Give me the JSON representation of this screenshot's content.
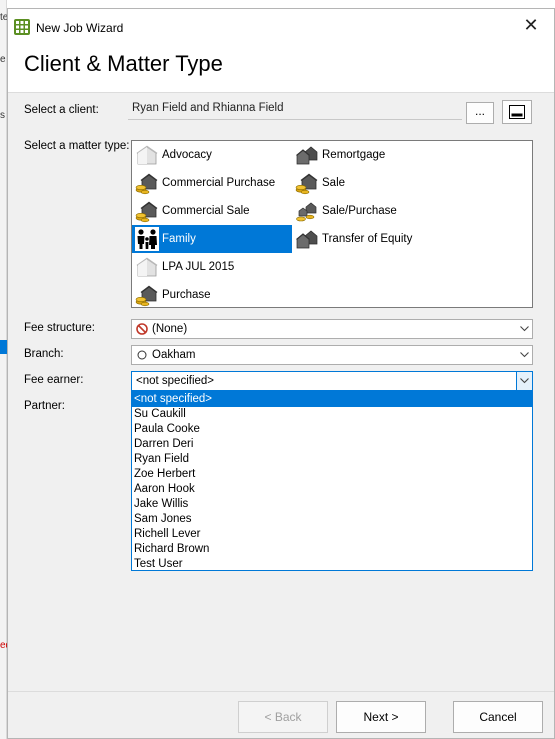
{
  "window": {
    "title": "New Job Wizard",
    "close_glyph": "✕"
  },
  "background": {
    "marks": [
      "te",
      "e",
      "s",
      "ed"
    ]
  },
  "page": {
    "title": "Client & Matter Type"
  },
  "labels": {
    "client": "Select a client:",
    "matter_type": "Select a matter type:",
    "fee_structure": "Fee structure:",
    "branch": "Branch:",
    "fee_earner": "Fee earner:",
    "partner": "Partner:"
  },
  "client": {
    "value": "Ryan Field and Rhianna Field",
    "browse_label": "...",
    "card_icon": "contact-card-icon"
  },
  "matter_types": [
    {
      "label": "Advocacy",
      "icon": "plain-house-icon",
      "selected": false
    },
    {
      "label": "Remortgage",
      "icon": "two-houses-icon",
      "selected": false
    },
    {
      "label": "Commercial Purchase",
      "icon": "house-coins-icon",
      "selected": false
    },
    {
      "label": "Sale",
      "icon": "house-coins-icon",
      "selected": false
    },
    {
      "label": "Commercial Sale",
      "icon": "house-coins-icon",
      "selected": false
    },
    {
      "label": "Sale/Purchase",
      "icon": "houses-coins-icon",
      "selected": false
    },
    {
      "label": "Family",
      "icon": "family-icon",
      "selected": true
    },
    {
      "label": "Transfer of Equity",
      "icon": "two-houses-icon",
      "selected": false
    },
    {
      "label": "LPA JUL 2015",
      "icon": "plain-house-icon",
      "selected": false
    },
    {
      "label": "Purchase",
      "icon": "house-coins-icon",
      "selected": false
    }
  ],
  "fee_structure": {
    "value": "(None)",
    "icon": "no-entry-icon"
  },
  "branch": {
    "value": "Oakham",
    "icon": "circle-icon"
  },
  "fee_earner": {
    "value": "<not specified>",
    "options": [
      "<not specified>",
      "Su Caukill",
      "Paula Cooke",
      "Darren Deri",
      "Ryan Field",
      "Zoe Herbert",
      "Aaron Hook",
      "Jake Willis",
      "Sam Jones",
      "Richell Lever",
      "Richard Brown",
      "Test User"
    ],
    "selected_index": 0
  },
  "buttons": {
    "back": "< Back",
    "next": "Next >",
    "cancel": "Cancel"
  },
  "colors": {
    "accent": "#0078d7",
    "dialog_bg": "#f0f0f0",
    "disabled_text": "#a0a0a0"
  }
}
